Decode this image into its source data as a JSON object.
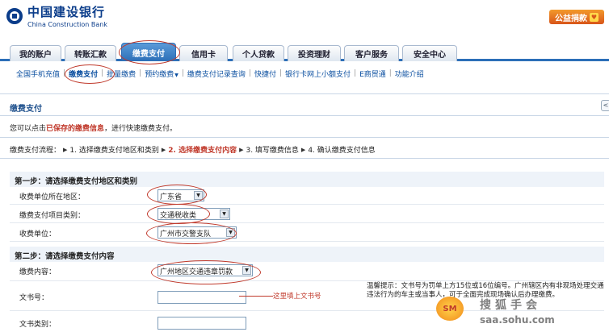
{
  "header": {
    "bank_name": "中国建设银行",
    "bank_name_en": "China Construction Bank",
    "charity_button": "公益捐款"
  },
  "tabs": [
    {
      "label": "我的账户"
    },
    {
      "label": "转账汇款"
    },
    {
      "label": "缴费支付",
      "active": true
    },
    {
      "label": "信用卡"
    },
    {
      "label": "个人贷款"
    },
    {
      "label": "投资理财"
    },
    {
      "label": "客户服务"
    },
    {
      "label": "安全中心"
    }
  ],
  "subnav": [
    {
      "label": "全国手机充值"
    },
    {
      "label": "缴费支付",
      "active": true
    },
    {
      "label": "批量缴费"
    },
    {
      "label": "预约缴费"
    },
    {
      "label": "缴费支付记录查询"
    },
    {
      "label": "快捷付"
    },
    {
      "label": "银行卡网上小额支付"
    },
    {
      "label": "E商贸通"
    },
    {
      "label": "功能介绍"
    }
  ],
  "section": {
    "title": "缴费支付",
    "info_prefix": "您可以点击",
    "info_link": "已保存的缴费信息",
    "info_suffix": "，进行快速缴费支付。"
  },
  "flow": {
    "label": "缴费支付流程：",
    "steps": [
      {
        "text": "1. 选择缴费支付地区和类别"
      },
      {
        "text": "2. 选择缴费支付内容",
        "current": true
      },
      {
        "text": "3. 填写缴费信息"
      },
      {
        "text": "4. 确认缴费支付信息"
      }
    ]
  },
  "step1": {
    "title": "第一步：请选择缴费支付地区和类别",
    "fields": {
      "region_label": "收费单位所在地区：",
      "region_value": "广东省",
      "category_label": "缴费支付项目类别：",
      "category_value": "交通税收类",
      "unit_label": "收费单位：",
      "unit_value": "广州市交警支队"
    }
  },
  "step2": {
    "title": "第二步：请选择缴费支付内容",
    "fields": {
      "content_label": "缴费内容：",
      "content_value": "广州地区交通违章罚款",
      "doc_no_label": "文书号：",
      "doc_type_label": "文书类别："
    }
  },
  "annotation": "这里填上文书号",
  "hint": "温馨提示：文书号为罚单上方15位或16位编号。广州辖区内有非现场处理交通违法行为的车主或当事人，可于全面完成现场确认后办理缴费。",
  "watermark": {
    "logo": "SM",
    "brand": "搜狐手会",
    "url": "saa.sohu.com"
  },
  "colors": {
    "accent": "#2c6fb8",
    "highlight": "#c0392b",
    "link": "#0b4fa0"
  }
}
